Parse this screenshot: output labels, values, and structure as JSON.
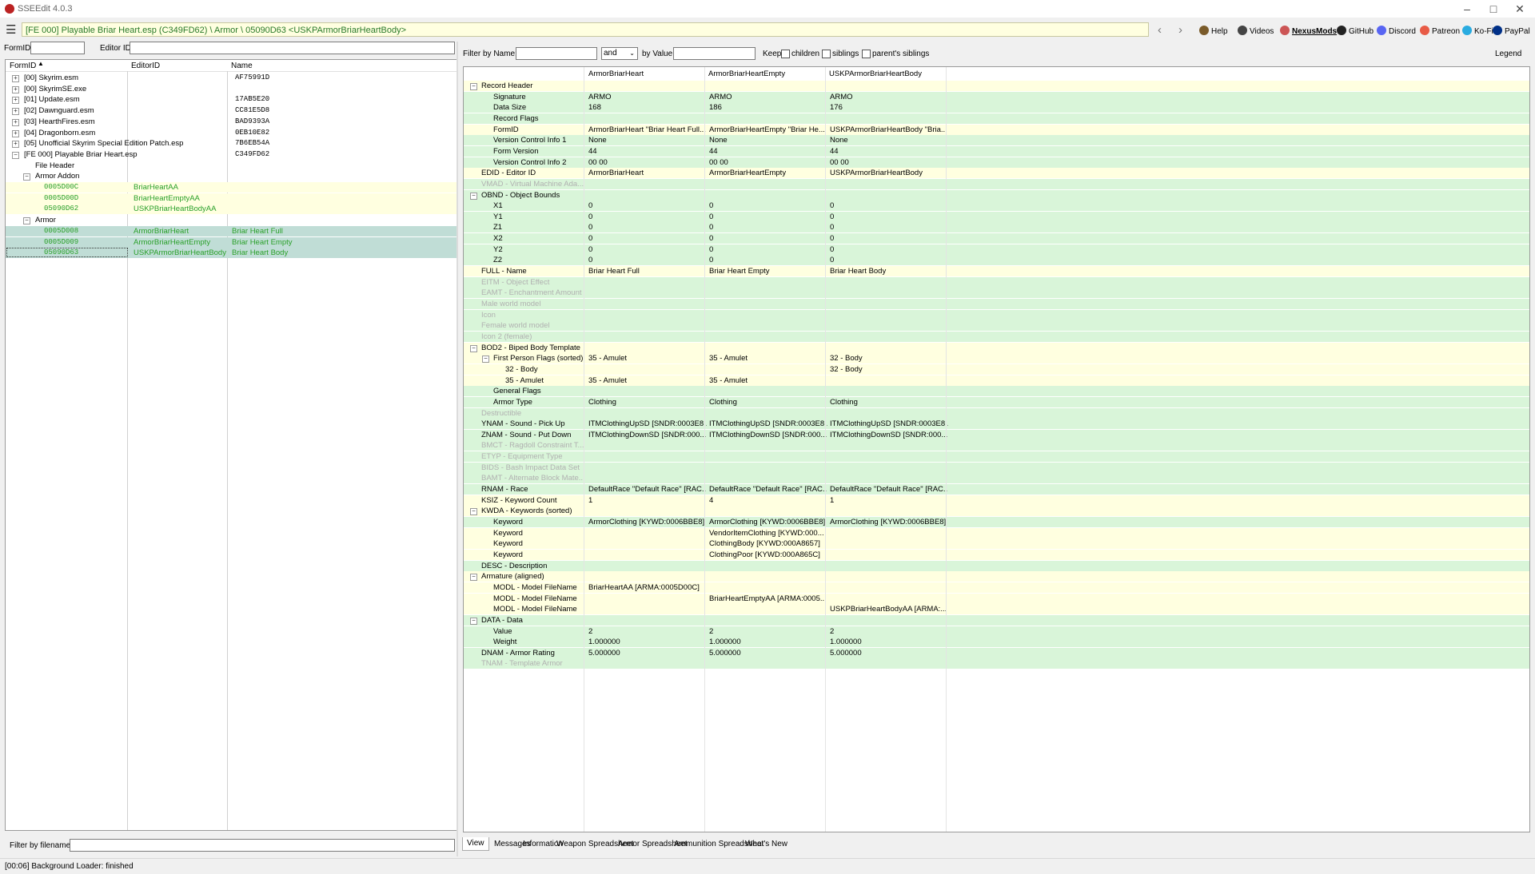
{
  "window": {
    "title": "SSEEdit 4.0.3"
  },
  "toolbar": {
    "path": "[FE 000] Playable Briar Heart.esp (C349FD62) \\ Armor \\ 05090D63 <USKPArmorBriarHeartBody>",
    "links": [
      {
        "label": "Help",
        "icon": "book-icon"
      },
      {
        "label": "Videos",
        "icon": "video-icon"
      },
      {
        "label": "NexusMods",
        "icon": "nexus-icon"
      },
      {
        "label": "GitHub",
        "icon": "github-icon"
      },
      {
        "label": "Discord",
        "icon": "discord-icon"
      },
      {
        "label": "Patreon",
        "icon": "patreon-icon"
      },
      {
        "label": "Ko-Fi",
        "icon": "kofi-icon"
      },
      {
        "label": "PayPal",
        "icon": "paypal-icon"
      }
    ]
  },
  "left": {
    "formid_label": "FormID",
    "editorid_label": "Editor ID",
    "columns": [
      "FormID",
      "EditorID",
      "Name"
    ],
    "tree": [
      {
        "indent": 0,
        "exp": "+",
        "label": "[00] Skyrim.esm",
        "editor": "",
        "name": "AF75991D",
        "style": "plain"
      },
      {
        "indent": 0,
        "exp": "+",
        "label": "[00] SkyrimSE.exe",
        "editor": "",
        "name": "",
        "style": "plain"
      },
      {
        "indent": 0,
        "exp": "+",
        "label": "[01] Update.esm",
        "editor": "",
        "name": "17AB5E20",
        "style": "plain"
      },
      {
        "indent": 0,
        "exp": "+",
        "label": "[02] Dawnguard.esm",
        "editor": "",
        "name": "CC81E5D8",
        "style": "plain"
      },
      {
        "indent": 0,
        "exp": "+",
        "label": "[03] HearthFires.esm",
        "editor": "",
        "name": "BAD9393A",
        "style": "plain"
      },
      {
        "indent": 0,
        "exp": "+",
        "label": "[04] Dragonborn.esm",
        "editor": "",
        "name": "0EB10E82",
        "style": "plain"
      },
      {
        "indent": 0,
        "exp": "+",
        "label": "[05] Unofficial Skyrim Special Edition Patch.esp",
        "editor": "",
        "name": "7B6EB54A",
        "style": "plain"
      },
      {
        "indent": 0,
        "exp": "-",
        "label": "[FE 000] Playable Briar Heart.esp",
        "editor": "",
        "name": "C349FD62",
        "style": "plain"
      },
      {
        "indent": 1,
        "exp": "",
        "label": "File Header",
        "editor": "",
        "name": "",
        "style": "plain"
      },
      {
        "indent": 1,
        "exp": "-",
        "label": "Armor Addon",
        "editor": "",
        "name": "",
        "style": "plain"
      },
      {
        "indent": 2,
        "exp": "",
        "label": "0005D00C",
        "editor": "BriarHeartAA",
        "name": "",
        "style": "yellow"
      },
      {
        "indent": 2,
        "exp": "",
        "label": "0005D00D",
        "editor": "BriarHeartEmptyAA",
        "name": "",
        "style": "yellow"
      },
      {
        "indent": 2,
        "exp": "",
        "label": "05090D62",
        "editor": "USKPBriarHeartBodyAA",
        "name": "",
        "style": "yellow"
      },
      {
        "indent": 1,
        "exp": "-",
        "label": "Armor",
        "editor": "",
        "name": "",
        "style": "plain"
      },
      {
        "indent": 2,
        "exp": "",
        "label": "0005D008",
        "editor": "ArmorBriarHeart",
        "name": "Briar Heart Full",
        "style": "sel"
      },
      {
        "indent": 2,
        "exp": "",
        "label": "0005D009",
        "editor": "ArmorBriarHeartEmpty",
        "name": "Briar Heart Empty",
        "style": "sel"
      },
      {
        "indent": 2,
        "exp": "",
        "label": "05090D63",
        "editor": "USKPArmorBriarHeartBody",
        "name": "Briar Heart Body",
        "style": "sel"
      }
    ],
    "filter_label": "Filter by filename:"
  },
  "right": {
    "filter_name_label": "Filter by Name:",
    "and_value": "and",
    "by_value_label": "by Value:",
    "keep_label": "Keep",
    "children_label": "children",
    "siblings_label": "siblings",
    "parents_label": "parent's siblings",
    "legend_label": "Legend",
    "columns": [
      "ArmorBriarHeart",
      "ArmorBriarHeartEmpty",
      "USKPArmorBriarHeartBody"
    ],
    "rows": [
      {
        "indent": 0,
        "exp": "-",
        "label": "Record Header",
        "bg": "yellow",
        "gray": false,
        "v": [
          "",
          "",
          ""
        ]
      },
      {
        "indent": 1,
        "exp": "",
        "label": "Signature",
        "bg": "green",
        "gray": false,
        "v": [
          "ARMO",
          "ARMO",
          "ARMO"
        ]
      },
      {
        "indent": 1,
        "exp": "",
        "label": "Data Size",
        "bg": "green",
        "gray": false,
        "v": [
          "168",
          "186",
          "176"
        ]
      },
      {
        "indent": 1,
        "exp": "",
        "label": "Record Flags",
        "bg": "green",
        "gray": false,
        "v": [
          "",
          "",
          ""
        ]
      },
      {
        "indent": 1,
        "exp": "",
        "label": "FormID",
        "bg": "yellow",
        "gray": false,
        "v": [
          "ArmorBriarHeart \"Briar Heart Full...",
          "ArmorBriarHeartEmpty \"Briar He...",
          "USKPArmorBriarHeartBody \"Bria..."
        ]
      },
      {
        "indent": 1,
        "exp": "",
        "label": "Version Control Info 1",
        "bg": "green",
        "gray": false,
        "v": [
          "None",
          "None",
          "None"
        ]
      },
      {
        "indent": 1,
        "exp": "",
        "label": "Form Version",
        "bg": "green",
        "gray": false,
        "v": [
          "44",
          "44",
          "44"
        ]
      },
      {
        "indent": 1,
        "exp": "",
        "label": "Version Control Info 2",
        "bg": "green",
        "gray": false,
        "v": [
          "00 00",
          "00 00",
          "00 00"
        ]
      },
      {
        "indent": 0,
        "exp": "",
        "label": "EDID - Editor ID",
        "bg": "yellow",
        "gray": false,
        "v": [
          "ArmorBriarHeart",
          "ArmorBriarHeartEmpty",
          "USKPArmorBriarHeartBody"
        ]
      },
      {
        "indent": 0,
        "exp": "",
        "label": "VMAD - Virtual Machine Ada...",
        "bg": "green",
        "gray": true,
        "v": [
          "",
          "",
          ""
        ]
      },
      {
        "indent": 0,
        "exp": "-",
        "label": "OBND - Object Bounds",
        "bg": "green",
        "gray": false,
        "v": [
          "",
          "",
          ""
        ]
      },
      {
        "indent": 1,
        "exp": "",
        "label": "X1",
        "bg": "green",
        "gray": false,
        "v": [
          "0",
          "0",
          "0"
        ]
      },
      {
        "indent": 1,
        "exp": "",
        "label": "Y1",
        "bg": "green",
        "gray": false,
        "v": [
          "0",
          "0",
          "0"
        ]
      },
      {
        "indent": 1,
        "exp": "",
        "label": "Z1",
        "bg": "green",
        "gray": false,
        "v": [
          "0",
          "0",
          "0"
        ]
      },
      {
        "indent": 1,
        "exp": "",
        "label": "X2",
        "bg": "green",
        "gray": false,
        "v": [
          "0",
          "0",
          "0"
        ]
      },
      {
        "indent": 1,
        "exp": "",
        "label": "Y2",
        "bg": "green",
        "gray": false,
        "v": [
          "0",
          "0",
          "0"
        ]
      },
      {
        "indent": 1,
        "exp": "",
        "label": "Z2",
        "bg": "green",
        "gray": false,
        "v": [
          "0",
          "0",
          "0"
        ]
      },
      {
        "indent": 0,
        "exp": "",
        "label": "FULL - Name",
        "bg": "yellow",
        "gray": false,
        "v": [
          "Briar Heart Full",
          "Briar Heart Empty",
          "Briar Heart Body"
        ]
      },
      {
        "indent": 0,
        "exp": "",
        "label": "EITM - Object Effect",
        "bg": "green",
        "gray": true,
        "v": [
          "",
          "",
          ""
        ]
      },
      {
        "indent": 0,
        "exp": "",
        "label": "EAMT - Enchantment Amount",
        "bg": "green",
        "gray": true,
        "v": [
          "",
          "",
          ""
        ]
      },
      {
        "indent": 0,
        "exp": "",
        "label": "Male world model",
        "bg": "green",
        "gray": true,
        "v": [
          "",
          "",
          ""
        ]
      },
      {
        "indent": 0,
        "exp": "",
        "label": "Icon",
        "bg": "green",
        "gray": true,
        "v": [
          "",
          "",
          ""
        ]
      },
      {
        "indent": 0,
        "exp": "",
        "label": "Female world model",
        "bg": "green",
        "gray": true,
        "v": [
          "",
          "",
          ""
        ]
      },
      {
        "indent": 0,
        "exp": "",
        "label": "Icon 2 (female)",
        "bg": "green",
        "gray": true,
        "v": [
          "",
          "",
          ""
        ]
      },
      {
        "indent": 0,
        "exp": "-",
        "label": "BOD2 - Biped Body Template",
        "bg": "yellow",
        "gray": false,
        "v": [
          "",
          "",
          ""
        ]
      },
      {
        "indent": 1,
        "exp": "-",
        "label": "First Person Flags (sorted)",
        "bg": "yellow",
        "gray": false,
        "v": [
          "35 - Amulet",
          "35 - Amulet",
          "32 - Body"
        ]
      },
      {
        "indent": 2,
        "exp": "",
        "label": "32 - Body",
        "bg": "yellow",
        "gray": false,
        "v": [
          "",
          "",
          "32 - Body"
        ]
      },
      {
        "indent": 2,
        "exp": "",
        "label": "35 - Amulet",
        "bg": "yellow",
        "gray": false,
        "v": [
          "35 - Amulet",
          "35 - Amulet",
          ""
        ]
      },
      {
        "indent": 1,
        "exp": "",
        "label": "General Flags",
        "bg": "green",
        "gray": false,
        "v": [
          "",
          "",
          ""
        ]
      },
      {
        "indent": 1,
        "exp": "",
        "label": "Armor Type",
        "bg": "green",
        "gray": false,
        "v": [
          "Clothing",
          "Clothing",
          "Clothing"
        ]
      },
      {
        "indent": 0,
        "exp": "",
        "label": "Destructible",
        "bg": "green",
        "gray": true,
        "v": [
          "",
          "",
          ""
        ]
      },
      {
        "indent": 0,
        "exp": "",
        "label": "YNAM - Sound - Pick Up",
        "bg": "green",
        "gray": false,
        "v": [
          "ITMClothingUpSD [SNDR:0003E8...",
          "ITMClothingUpSD [SNDR:0003E8...",
          "ITMClothingUpSD [SNDR:0003E8..."
        ]
      },
      {
        "indent": 0,
        "exp": "",
        "label": "ZNAM - Sound - Put Down",
        "bg": "green",
        "gray": false,
        "v": [
          "ITMClothingDownSD [SNDR:000...",
          "ITMClothingDownSD [SNDR:000...",
          "ITMClothingDownSD [SNDR:000..."
        ]
      },
      {
        "indent": 0,
        "exp": "",
        "label": "BMCT - Ragdoll Constraint T...",
        "bg": "green",
        "gray": true,
        "v": [
          "",
          "",
          ""
        ]
      },
      {
        "indent": 0,
        "exp": "",
        "label": "ETYP - Equipment Type",
        "bg": "green",
        "gray": true,
        "v": [
          "",
          "",
          ""
        ]
      },
      {
        "indent": 0,
        "exp": "",
        "label": "BIDS - Bash Impact Data Set",
        "bg": "green",
        "gray": true,
        "v": [
          "",
          "",
          ""
        ]
      },
      {
        "indent": 0,
        "exp": "",
        "label": "BAMT - Alternate Block Mate...",
        "bg": "green",
        "gray": true,
        "v": [
          "",
          "",
          ""
        ]
      },
      {
        "indent": 0,
        "exp": "",
        "label": "RNAM - Race",
        "bg": "green",
        "gray": false,
        "v": [
          "DefaultRace \"Default Race\" [RAC...",
          "DefaultRace \"Default Race\" [RAC...",
          "DefaultRace \"Default Race\" [RAC..."
        ]
      },
      {
        "indent": 0,
        "exp": "",
        "label": "KSIZ - Keyword Count",
        "bg": "yellow",
        "gray": false,
        "v": [
          "1",
          "4",
          "1"
        ]
      },
      {
        "indent": 0,
        "exp": "-",
        "label": "KWDA - Keywords (sorted)",
        "bg": "yellow",
        "gray": false,
        "v": [
          "",
          "",
          ""
        ]
      },
      {
        "indent": 1,
        "exp": "",
        "label": "Keyword",
        "bg": "green",
        "gray": false,
        "v": [
          "ArmorClothing [KYWD:0006BBE8]",
          "ArmorClothing [KYWD:0006BBE8]",
          "ArmorClothing [KYWD:0006BBE8]"
        ]
      },
      {
        "indent": 1,
        "exp": "",
        "label": "Keyword",
        "bg": "yellow",
        "gray": false,
        "v": [
          "",
          "VendorItemClothing [KYWD:000...",
          ""
        ]
      },
      {
        "indent": 1,
        "exp": "",
        "label": "Keyword",
        "bg": "yellow",
        "gray": false,
        "v": [
          "",
          "ClothingBody [KYWD:000A8657]",
          ""
        ]
      },
      {
        "indent": 1,
        "exp": "",
        "label": "Keyword",
        "bg": "yellow",
        "gray": false,
        "v": [
          "",
          "ClothingPoor [KYWD:000A865C]",
          ""
        ]
      },
      {
        "indent": 0,
        "exp": "",
        "label": "DESC - Description",
        "bg": "green",
        "gray": false,
        "v": [
          "",
          "",
          ""
        ]
      },
      {
        "indent": 0,
        "exp": "-",
        "label": "Armature (aligned)",
        "bg": "yellow",
        "gray": false,
        "v": [
          "",
          "",
          ""
        ]
      },
      {
        "indent": 1,
        "exp": "",
        "label": "MODL - Model FileName",
        "bg": "yellow",
        "gray": false,
        "v": [
          "BriarHeartAA [ARMA:0005D00C]",
          "",
          ""
        ]
      },
      {
        "indent": 1,
        "exp": "",
        "label": "MODL - Model FileName",
        "bg": "yellow",
        "gray": false,
        "v": [
          "",
          "BriarHeartEmptyAA [ARMA:0005...",
          ""
        ]
      },
      {
        "indent": 1,
        "exp": "",
        "label": "MODL - Model FileName",
        "bg": "yellow",
        "gray": false,
        "v": [
          "",
          "",
          "USKPBriarHeartBodyAA [ARMA:..."
        ]
      },
      {
        "indent": 0,
        "exp": "-",
        "label": "DATA - Data",
        "bg": "green",
        "gray": false,
        "v": [
          "",
          "",
          ""
        ]
      },
      {
        "indent": 1,
        "exp": "",
        "label": "Value",
        "bg": "green",
        "gray": false,
        "v": [
          "2",
          "2",
          "2"
        ]
      },
      {
        "indent": 1,
        "exp": "",
        "label": "Weight",
        "bg": "green",
        "gray": false,
        "v": [
          "1.000000",
          "1.000000",
          "1.000000"
        ]
      },
      {
        "indent": 0,
        "exp": "",
        "label": "DNAM - Armor Rating",
        "bg": "green",
        "gray": false,
        "v": [
          "5.000000",
          "5.000000",
          "5.000000"
        ]
      },
      {
        "indent": 0,
        "exp": "",
        "label": "TNAM - Template Armor",
        "bg": "green",
        "gray": true,
        "v": [
          "",
          "",
          ""
        ]
      }
    ],
    "tabs": [
      "View",
      "Messages",
      "Information",
      "Weapon Spreadsheet",
      "Armor Spreadsheet",
      "Ammunition Spreadsheet",
      "What's New"
    ]
  },
  "status": {
    "text": "[00:06] Background Loader: finished"
  },
  "colors": {
    "green_row": "#d9f5d9",
    "yellow_row": "#ffffe0",
    "selected_row": "#c0ddd6",
    "editor_text": "#2aa02a"
  }
}
